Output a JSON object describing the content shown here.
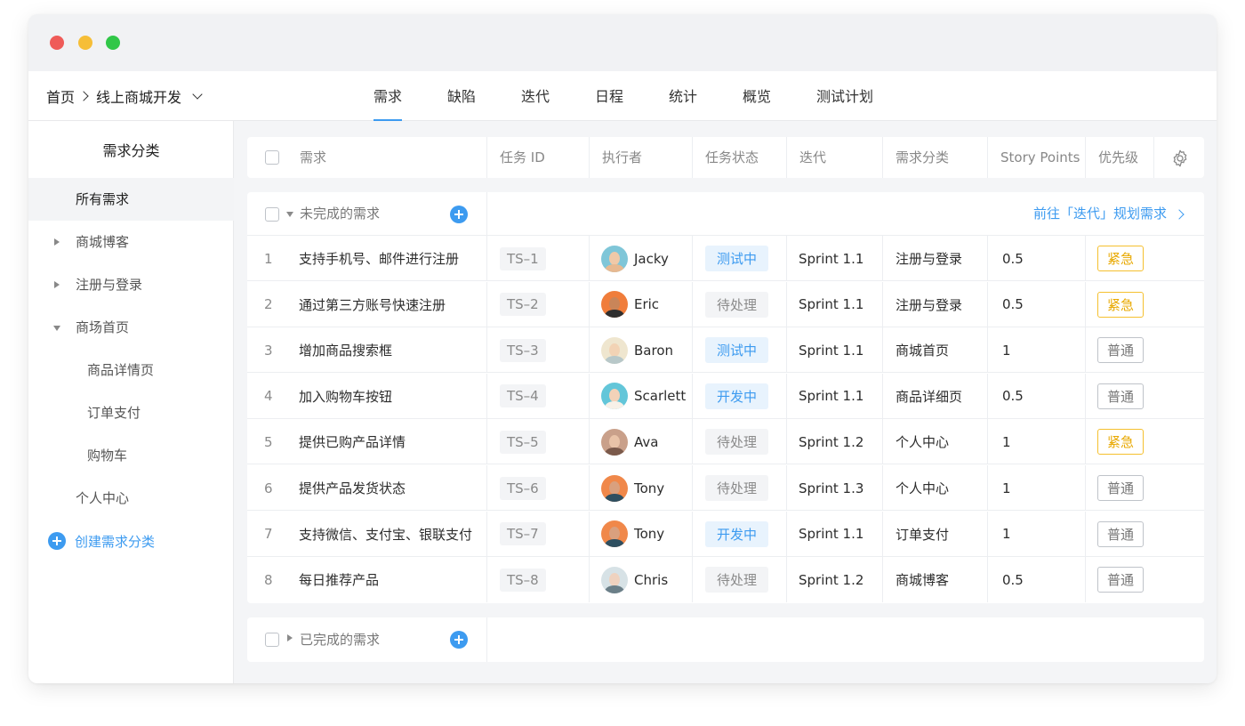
{
  "breadcrumb": {
    "home": "首页",
    "project": "线上商城开发"
  },
  "tabs": [
    {
      "label": "需求",
      "active": true
    },
    {
      "label": "缺陷",
      "active": false
    },
    {
      "label": "迭代",
      "active": false
    },
    {
      "label": "日程",
      "active": false
    },
    {
      "label": "统计",
      "active": false
    },
    {
      "label": "概览",
      "active": false
    },
    {
      "label": "测试计划",
      "active": false
    }
  ],
  "sidebar": {
    "title": "需求分类",
    "items": [
      {
        "label": "所有需求",
        "active": true
      },
      {
        "label": "商城博客",
        "expander": "collapsed"
      },
      {
        "label": "注册与登录",
        "expander": "collapsed"
      },
      {
        "label": "商场首页",
        "expander": "expanded"
      },
      {
        "label": "商品详情页",
        "sub": true
      },
      {
        "label": "订单支付",
        "sub": true
      },
      {
        "label": "购物车",
        "sub": true
      },
      {
        "label": "个人中心"
      }
    ],
    "create_label": "创建需求分类"
  },
  "table_header": [
    "需求",
    "任务 ID",
    "执行者",
    "任务状态",
    "迭代",
    "需求分类",
    "Story Points",
    "优先级"
  ],
  "incomplete_group": {
    "title": "未完成的需求",
    "plan_link": "前往「迭代」规划需求",
    "rows": [
      {
        "num": "1",
        "title": "支持手机号、邮件进行注册",
        "id": "TS–1",
        "assignee": "Jacky",
        "status": "测试中",
        "status_kind": "testing",
        "iteration": "Sprint 1.1",
        "category": "注册与登录",
        "points": "0.5",
        "priority": "紧急",
        "priority_kind": "urgent"
      },
      {
        "num": "2",
        "title": "通过第三方账号快速注册",
        "id": "TS–2",
        "assignee": "Eric",
        "status": "待处理",
        "status_kind": "pending",
        "iteration": "Sprint 1.1",
        "category": "注册与登录",
        "points": "0.5",
        "priority": "紧急",
        "priority_kind": "urgent"
      },
      {
        "num": "3",
        "title": "增加商品搜索框",
        "id": "TS–3",
        "assignee": "Baron",
        "status": "测试中",
        "status_kind": "testing",
        "iteration": "Sprint 1.1",
        "category": "商城首页",
        "points": "1",
        "priority": "普通",
        "priority_kind": "normal"
      },
      {
        "num": "4",
        "title": "加入购物车按钮",
        "id": "TS–4",
        "assignee": "Scarlett",
        "status": "开发中",
        "status_kind": "dev",
        "iteration": "Sprint 1.1",
        "category": "商品详细页",
        "points": "0.5",
        "priority": "普通",
        "priority_kind": "normal"
      },
      {
        "num": "5",
        "title": "提供已购产品详情",
        "id": "TS–5",
        "assignee": "Ava",
        "status": "待处理",
        "status_kind": "pending",
        "iteration": "Sprint 1.2",
        "category": "个人中心",
        "points": "1",
        "priority": "紧急",
        "priority_kind": "urgent"
      },
      {
        "num": "6",
        "title": "提供产品发货状态",
        "id": "TS–6",
        "assignee": "Tony",
        "status": "待处理",
        "status_kind": "pending",
        "iteration": "Sprint 1.3",
        "category": "个人中心",
        "points": "1",
        "priority": "普通",
        "priority_kind": "normal"
      },
      {
        "num": "7",
        "title": "支持微信、支付宝、银联支付",
        "id": "TS–7",
        "assignee": "Tony",
        "status": "开发中",
        "status_kind": "dev",
        "iteration": "Sprint 1.1",
        "category": "订单支付",
        "points": "1",
        "priority": "普通",
        "priority_kind": "normal"
      },
      {
        "num": "8",
        "title": "每日推荐产品",
        "id": "TS–8",
        "assignee": "Chris",
        "status": "待处理",
        "status_kind": "pending",
        "iteration": "Sprint 1.2",
        "category": "商城博客",
        "points": "0.5",
        "priority": "普通",
        "priority_kind": "normal"
      }
    ]
  },
  "complete_group": {
    "title": "已完成的需求"
  },
  "colors": {
    "accent": "#3d9bf0",
    "urgent": "#f5c02f",
    "window_close": "#ef5b58",
    "window_minimize": "#f6be37",
    "window_maximize": "#31c748"
  }
}
